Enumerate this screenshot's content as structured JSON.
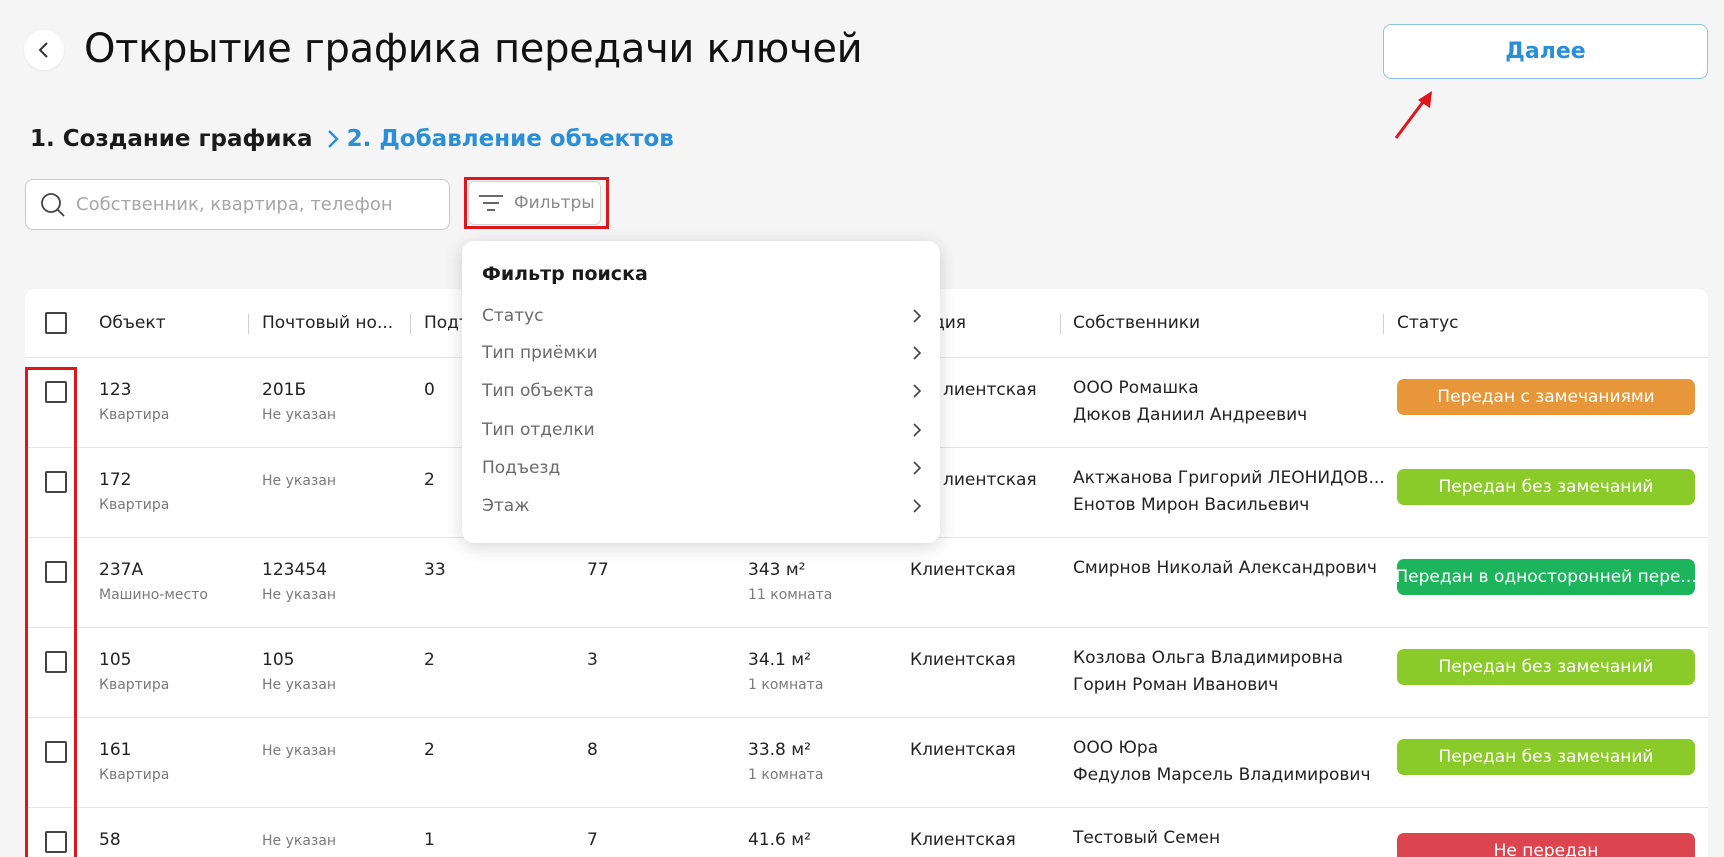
{
  "header": {
    "title": "Открытие графика передачи ключей",
    "next_label": "Далее"
  },
  "breadcrumb": {
    "step1": "1. Создание графика",
    "step2": "2. Добавление объектов"
  },
  "search": {
    "placeholder": "Собственник, квартира, телефон"
  },
  "filter_button": {
    "label": "Фильтры"
  },
  "filter_dropdown": {
    "title": "Фильтр поиска",
    "items": [
      "Статус",
      "Тип приёмки",
      "Тип объекта",
      "Тип отделки",
      "Подъезд",
      "Этаж"
    ]
  },
  "table": {
    "columns": {
      "object": "Объект",
      "postal": "Почтовый но...",
      "entrance": "Подъ",
      "stage": "дия",
      "owners": "Собственники",
      "status": "Статус"
    },
    "rows": [
      {
        "object": "123",
        "object_type": "Квартира",
        "postal": "201Б",
        "postal_sub": "Не указан",
        "entrance": "0",
        "floor": "",
        "area": "",
        "area_sub": "",
        "stage": "лиентская",
        "owners": [
          "ООО Ромашка",
          "Дюков Даниил Андреевич"
        ],
        "status": "Передан с замечаниями",
        "status_color": "#e8963a"
      },
      {
        "object": "172",
        "object_type": "Квартира",
        "postal": "Не указан",
        "postal_sub": "",
        "entrance": "2",
        "floor": "",
        "area": "",
        "area_sub": "",
        "stage": "лиентская",
        "owners": [
          "Актжанова Григорий ЛЕОНИДОВ...",
          "Енотов Мирон Васильевич"
        ],
        "status": "Передан без замечаний",
        "status_color": "#8acb2a"
      },
      {
        "object": "237А",
        "object_type": "Машино-место",
        "postal": "123454",
        "postal_sub": "Не указан",
        "entrance": "33",
        "floor": "77",
        "area": "343 м²",
        "area_sub": "11 комната",
        "stage": "Клиентская",
        "owners": [
          "Смирнов Николай Александрович"
        ],
        "status": "Передан в односторонней пере...",
        "status_color": "#1db55c"
      },
      {
        "object": "105",
        "object_type": "Квартира",
        "postal": "105",
        "postal_sub": "Не указан",
        "entrance": "2",
        "floor": "3",
        "area": "34.1 м²",
        "area_sub": "1 комната",
        "stage": "Клиентская",
        "owners": [
          "Козлова Ольга Владимировна",
          "Горин Роман Иванович"
        ],
        "status": "Передан без замечаний",
        "status_color": "#8acb2a"
      },
      {
        "object": "161",
        "object_type": "Квартира",
        "postal": "Не указан",
        "postal_sub": "",
        "entrance": "2",
        "floor": "8",
        "area": "33.8 м²",
        "area_sub": "1 комната",
        "stage": "Клиентская",
        "owners": [
          "ООО Юра",
          "Федулов Марсель Владимирович"
        ],
        "status": "Передан без замечаний",
        "status_color": "#8acb2a"
      },
      {
        "object": "58",
        "object_type": "",
        "postal": "Не указан",
        "postal_sub": "",
        "entrance": "1",
        "floor": "7",
        "area": "41.6 м²",
        "area_sub": "",
        "stage": "Клиентская",
        "owners": [
          "Тестовый Семен"
        ],
        "status": "Не передан",
        "status_color": "#dc4550"
      }
    ]
  },
  "colors": {
    "accent": "#2a8fd6",
    "highlight": "#e0161d"
  }
}
